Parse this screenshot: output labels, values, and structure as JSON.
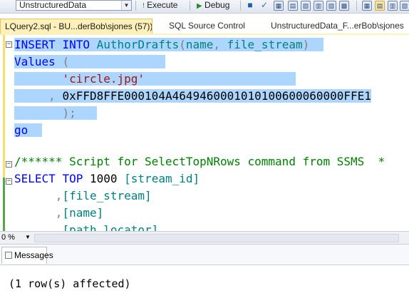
{
  "toolbar": {
    "database": "UnstructuredData",
    "execute_label": "Execute",
    "debug_label": "Debug"
  },
  "tabs": [
    {
      "label": "LQuery2.sql - BU...derBob\\sjones (57))*",
      "close": "×",
      "active": true
    },
    {
      "label": "SQL Source Control",
      "active": false
    },
    {
      "label": "UnstructuredData_F...erBob\\sjones",
      "active": false
    }
  ],
  "editor": {
    "line1": {
      "kw1": "INSERT",
      "kw2": "INTO",
      "table": "AuthorDrafts",
      "paren_open": "(",
      "col1": "name",
      "comma": ",",
      "col2": "file_stream",
      "paren_close": ")"
    },
    "line2": {
      "kw": "Values",
      "paren": "("
    },
    "line3": {
      "str": "'circle.jpg'"
    },
    "line4": {
      "comma": ",",
      "hex": "0xFFD8FFE000104A4649460001010100600060000FFE1"
    },
    "line5": {
      "close": ");"
    },
    "line6": {
      "kw": "go"
    },
    "line7": {
      "comment": "/****** Script for SelectTopNRows command from SSMS  *"
    },
    "line8": {
      "kw1": "SELECT",
      "kw2": "TOP",
      "num": "1000",
      "col": "[stream_id]"
    },
    "line9": {
      "comma": ",",
      "col": "[file_stream]"
    },
    "line10": {
      "comma": ",",
      "col": "[name]"
    },
    "line11": {
      "comma": ",",
      "col": "[path_locator]"
    }
  },
  "zoom": {
    "level": "0 %"
  },
  "results": {
    "tab_label": "Messages",
    "output": "(1 row(s) affected)"
  }
}
